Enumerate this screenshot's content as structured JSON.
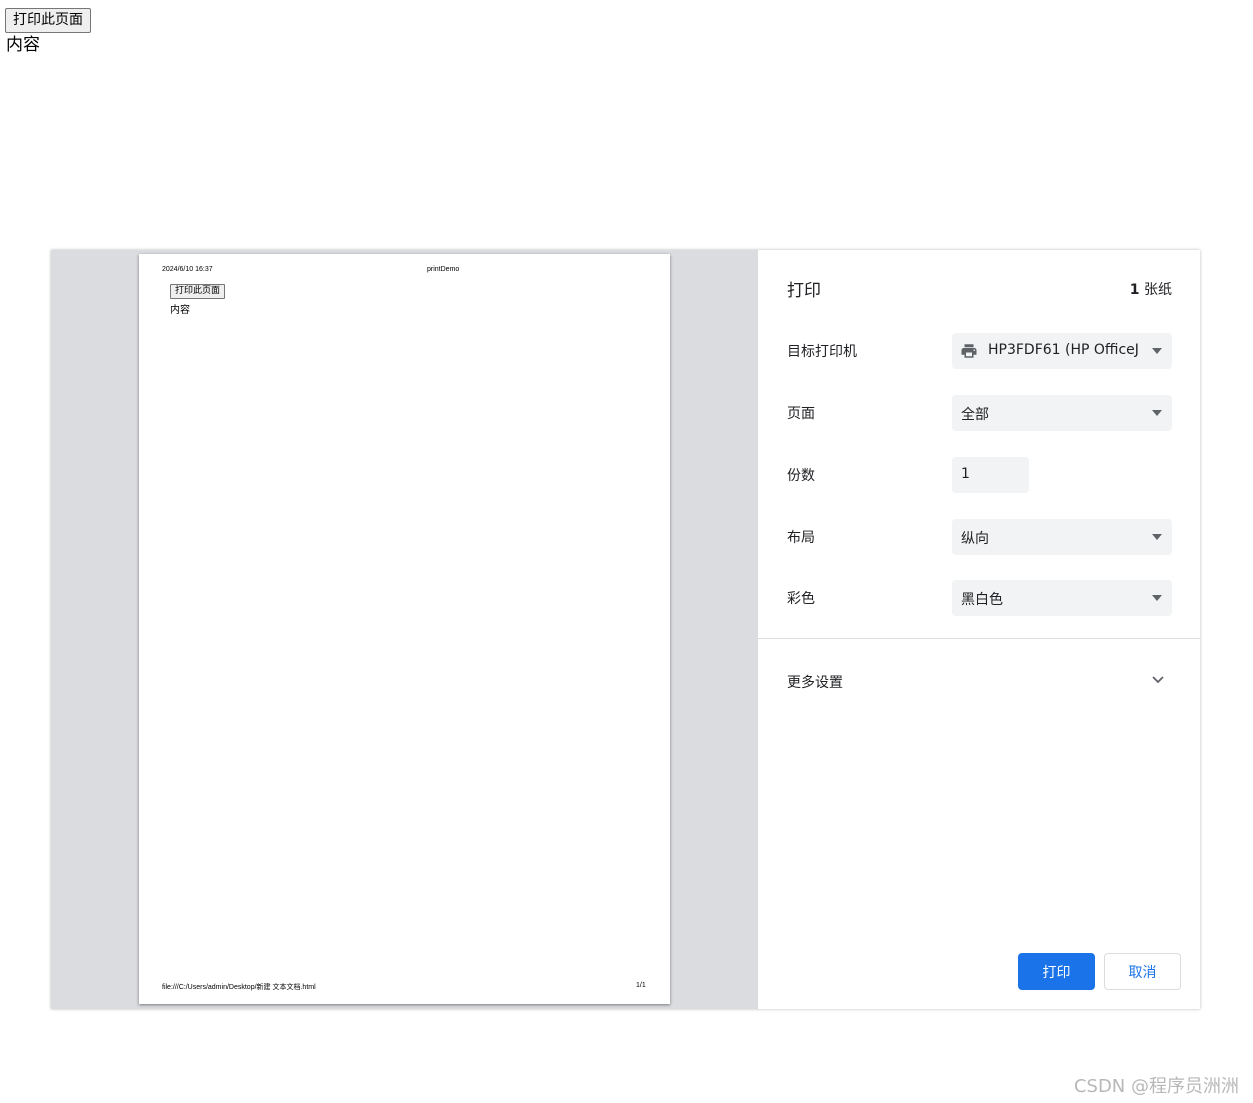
{
  "page": {
    "print_button_label": "打印此页面",
    "content_text": "内容"
  },
  "preview": {
    "header_date": "2024/6/10 16:37",
    "header_title": "printDemo",
    "button_label": "打印此页面",
    "content_text": "内容",
    "footer_path": "file:///C:/Users/admin/Desktop/新建 文本文档.html",
    "footer_page": "1/1"
  },
  "settings": {
    "title": "打印",
    "sheet_count_number": "1",
    "sheet_count_unit": " 张纸",
    "destination": {
      "label": "目标打印机",
      "value": "HP3FDF61 (HP OfficeJet"
    },
    "pages": {
      "label": "页面",
      "value": "全部"
    },
    "copies": {
      "label": "份数",
      "value": "1"
    },
    "layout": {
      "label": "布局",
      "value": "纵向"
    },
    "color": {
      "label": "彩色",
      "value": "黑白色"
    },
    "more_settings": "更多设置",
    "print_button": "打印",
    "cancel_button": "取消"
  },
  "watermark": "CSDN @程序员洲洲",
  "colors": {
    "accent": "#1a73e8",
    "preview_bg": "#dadce0",
    "field_bg": "#f1f3f4"
  },
  "icons": [
    "printer-icon",
    "dropdown-caret-icon",
    "chevron-down-icon"
  ]
}
